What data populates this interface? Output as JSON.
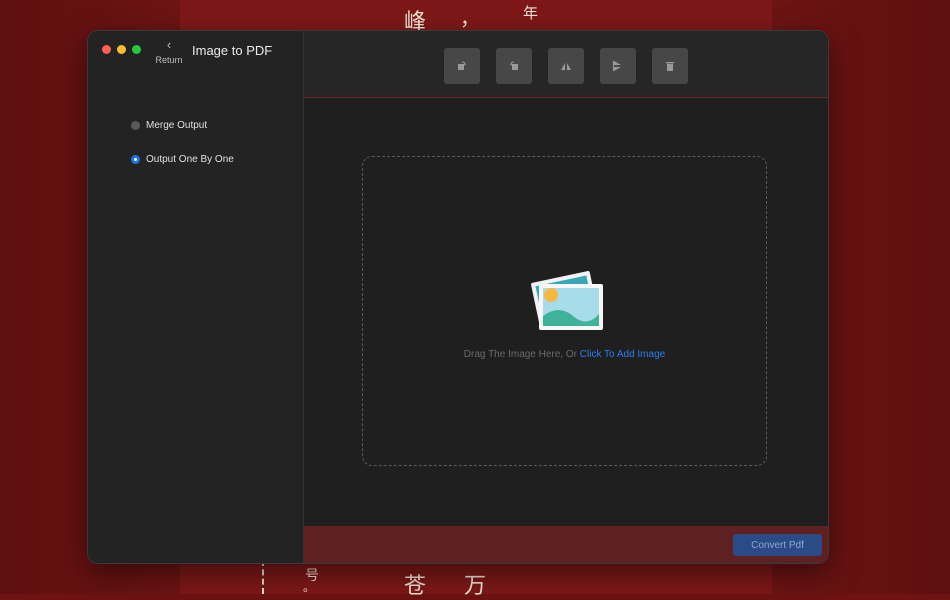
{
  "background": {
    "chars": [
      "峰",
      "，",
      "年",
      "号",
      "。",
      "苍",
      "万"
    ]
  },
  "window": {
    "title": "Image to PDF",
    "return_label": "Return"
  },
  "sidebar": {
    "options": [
      {
        "label": "Merge Output",
        "selected": false
      },
      {
        "label": "Output One By One",
        "selected": true
      }
    ]
  },
  "toolbar": {
    "buttons": [
      {
        "name": "rotate-left-icon"
      },
      {
        "name": "rotate-right-icon"
      },
      {
        "name": "flip-vertical-icon"
      },
      {
        "name": "flip-horizontal-icon"
      },
      {
        "name": "trash-icon"
      }
    ]
  },
  "dropzone": {
    "hint_text": "Drag The Image Here, Or ",
    "link_text": "Click To Add Image"
  },
  "footer": {
    "convert_label": "Convert Pdf"
  },
  "colors": {
    "accent": "#1e73e8",
    "link": "#2b7ef0",
    "divider": "#6b2727"
  }
}
